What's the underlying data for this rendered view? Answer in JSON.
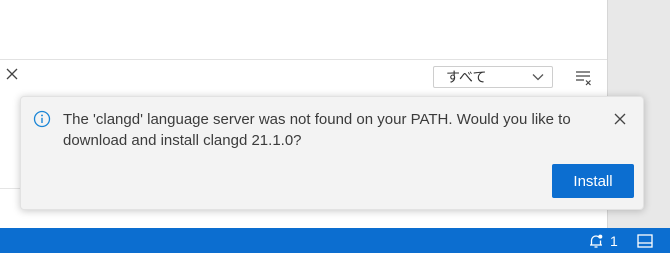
{
  "panel": {
    "filter": {
      "selected": "すべて",
      "icon": "chevron-down-icon"
    },
    "clear_icon": "clear-all-icon",
    "close_icon": "close-icon"
  },
  "notification": {
    "icon": "info-icon",
    "message": "The 'clangd' language server was not found on your PATH. Would you like to download and install clangd 21.1.0?",
    "primary_action": "Install",
    "close_icon": "close-icon"
  },
  "status_bar": {
    "notification_count": "1",
    "bell_icon": "bell-dot-icon",
    "layout_icon": "panel-layout-icon"
  },
  "colors": {
    "accent": "#0c6ed0",
    "toast_bg": "#f3f3f3",
    "info_icon": "#1a85d6"
  }
}
